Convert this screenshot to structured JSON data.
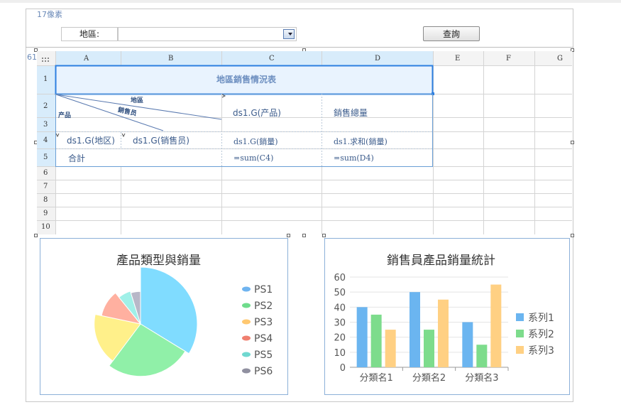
{
  "param_panel": {
    "height_label": "17像素",
    "region_label": "地區:",
    "region_value": "",
    "query_button": "查詢"
  },
  "report": {
    "height_label": "61像素",
    "columns": [
      "A",
      "B",
      "C",
      "D",
      "E",
      "F",
      "G"
    ],
    "rows": [
      "1",
      "2",
      "3",
      "4",
      "5",
      "6",
      "7",
      "8",
      "9",
      "10"
    ],
    "title": "地區銷售情況表",
    "header": {
      "diag_region": "地區",
      "diag_salesman": "銷售员",
      "diag_product": "产品",
      "product_cell": "ds1.G(产品)",
      "total_sales_cell": "銷售總量"
    },
    "data_row": {
      "region": "ds1.G(地区)",
      "salesman": "ds1.G(销售员)",
      "quantity": "ds1.G(銷量)",
      "sum_quantity": "ds1.求和(銷量)"
    },
    "total_row": {
      "label": "合計",
      "sum_c": "=sum(C4)",
      "sum_d": "=sum(D4)"
    }
  },
  "chart_data": [
    {
      "type": "pie",
      "title": "產品類型與銷量",
      "categories": [
        "PS1",
        "PS2",
        "PS3",
        "PS4",
        "PS5",
        "PS6"
      ],
      "values": [
        28,
        22,
        15,
        9,
        5,
        4
      ],
      "colors": [
        "#80dcff",
        "#90f0a8",
        "#fff08a",
        "#ffb0a0",
        "#a0f0e8",
        "#b8b8c8"
      ],
      "legend_colors": [
        "#6fb4f0",
        "#6fdc8c",
        "#ffc870",
        "#f08070",
        "#70d8d0",
        "#9090a0"
      ],
      "legend_position": "right"
    },
    {
      "type": "bar",
      "title": "銷售員產品銷量統計",
      "categories": [
        "分類名1",
        "分類名2",
        "分類名3"
      ],
      "series": [
        {
          "name": "系列1",
          "values": [
            40,
            50,
            30
          ],
          "color": "#6bb5f0"
        },
        {
          "name": "系列2",
          "values": [
            35,
            25,
            15
          ],
          "color": "#7ddc8c"
        },
        {
          "name": "系列3",
          "values": [
            25,
            45,
            55
          ],
          "color": "#ffd083"
        }
      ],
      "ylim": [
        0,
        60
      ],
      "yticks": [
        0,
        10,
        20,
        30,
        40,
        50,
        60
      ],
      "grid": true,
      "legend_position": "right"
    }
  ]
}
